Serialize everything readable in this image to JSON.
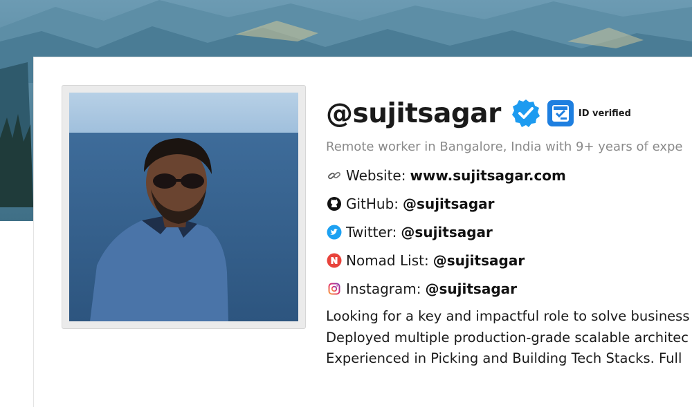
{
  "profile": {
    "handle": "@sujitsagar",
    "id_verified_label": "ID verified",
    "tagline": "Remote worker in Bangalore, India with 9+ years of expe",
    "links": [
      {
        "icon": "link-icon",
        "label": "Website:",
        "value": "www.sujitsagar.com"
      },
      {
        "icon": "github-icon",
        "label": "GitHub:",
        "value": "@sujitsagar"
      },
      {
        "icon": "twitter-icon",
        "label": "Twitter:",
        "value": "@sujitsagar"
      },
      {
        "icon": "nomad-list-icon",
        "label": "Nomad List:",
        "value": "@sujitsagar"
      },
      {
        "icon": "instagram-icon",
        "label": "Instagram:",
        "value": "@sujitsagar"
      }
    ],
    "about_lines": [
      "Looking for a key and impactful role to solve business",
      "Deployed multiple production-grade scalable architec",
      "Experienced in Picking and Building Tech Stacks. Full"
    ]
  },
  "colors": {
    "verified_blue": "#1d9bf0",
    "twitter_blue": "#1da1f2",
    "nomad_red": "#e8433b",
    "handle_text": "#1a1a1a",
    "tagline_gray": "#8a8a8a"
  }
}
